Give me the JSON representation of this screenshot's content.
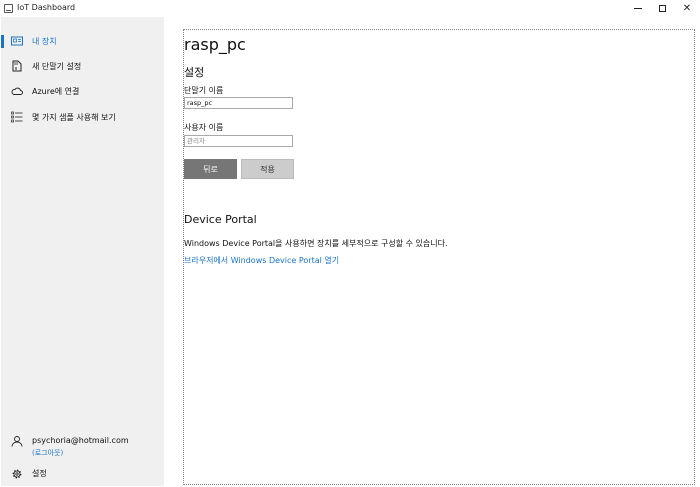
{
  "window": {
    "title": "IoT Dashboard"
  },
  "sidebar": {
    "items": [
      {
        "label": "내 장치",
        "icon": "device-icon",
        "active": true
      },
      {
        "label": "새 단말기 설정",
        "icon": "sdcard-icon",
        "active": false
      },
      {
        "label": "Azure에 연결",
        "icon": "cloud-icon",
        "active": false
      },
      {
        "label": "몇 가지 샘플 사용해 보기",
        "icon": "list-icon",
        "active": false
      }
    ],
    "user": {
      "email": "psychoria@hotmail.com",
      "logout_label": "(로그아웃)"
    },
    "settings_label": "설정"
  },
  "main": {
    "device_name": "rasp_pc",
    "section_title": "설정",
    "device_name_label": "단말기 이름",
    "device_name_value": "rasp_pc",
    "username_label": "사용자 이름",
    "username_placeholder": "관리자",
    "back_label": "뒤로",
    "apply_label": "적용",
    "portal_title": "Device Portal",
    "portal_description": "Windows Device Portal을 사용하면 장치를 세부적으로 구성할 수 있습니다.",
    "portal_link": "브라우저에서 Windows Device Portal 열기"
  },
  "colors": {
    "accent": "#1a73c6",
    "sidebar_bg": "#f0f0f0",
    "back_button": "#767676",
    "apply_button": "#cccccc"
  }
}
